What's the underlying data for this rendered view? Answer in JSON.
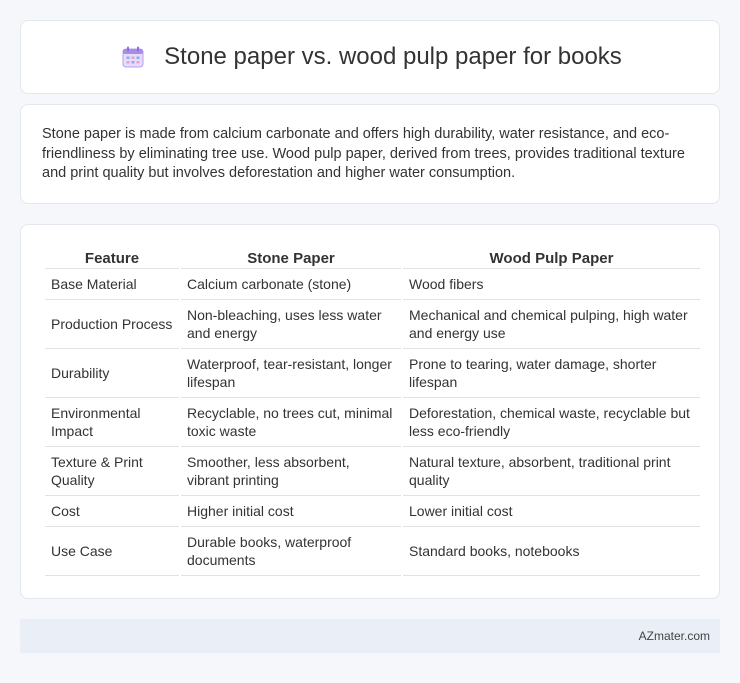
{
  "header": {
    "title": "Stone paper vs. wood pulp paper for books",
    "icon": "calendar-icon"
  },
  "intro": {
    "text": "Stone paper is made from calcium carbonate and offers high durability, water resistance, and eco-friendliness by eliminating tree use. Wood pulp paper, derived from trees, provides traditional texture and print quality but involves deforestation and higher water consumption."
  },
  "table": {
    "headers": [
      "Feature",
      "Stone Paper",
      "Wood Pulp Paper"
    ],
    "rows": [
      [
        "Base Material",
        "Calcium carbonate (stone)",
        "Wood fibers"
      ],
      [
        "Production Process",
        "Non-bleaching, uses less water and energy",
        "Mechanical and chemical pulping, high water and energy use"
      ],
      [
        "Durability",
        "Waterproof, tear-resistant, longer lifespan",
        "Prone to tearing, water damage, shorter lifespan"
      ],
      [
        "Environmental Impact",
        "Recyclable, no trees cut, minimal toxic waste",
        "Deforestation, chemical waste, recyclable but less eco-friendly"
      ],
      [
        "Texture & Print Quality",
        "Smoother, less absorbent, vibrant printing",
        "Natural texture, absorbent, traditional print quality"
      ],
      [
        "Cost",
        "Higher initial cost",
        "Lower initial cost"
      ],
      [
        "Use Case",
        "Durable books, waterproof documents",
        "Standard books, notebooks"
      ]
    ]
  },
  "footer": {
    "text": "AZmater.com"
  }
}
